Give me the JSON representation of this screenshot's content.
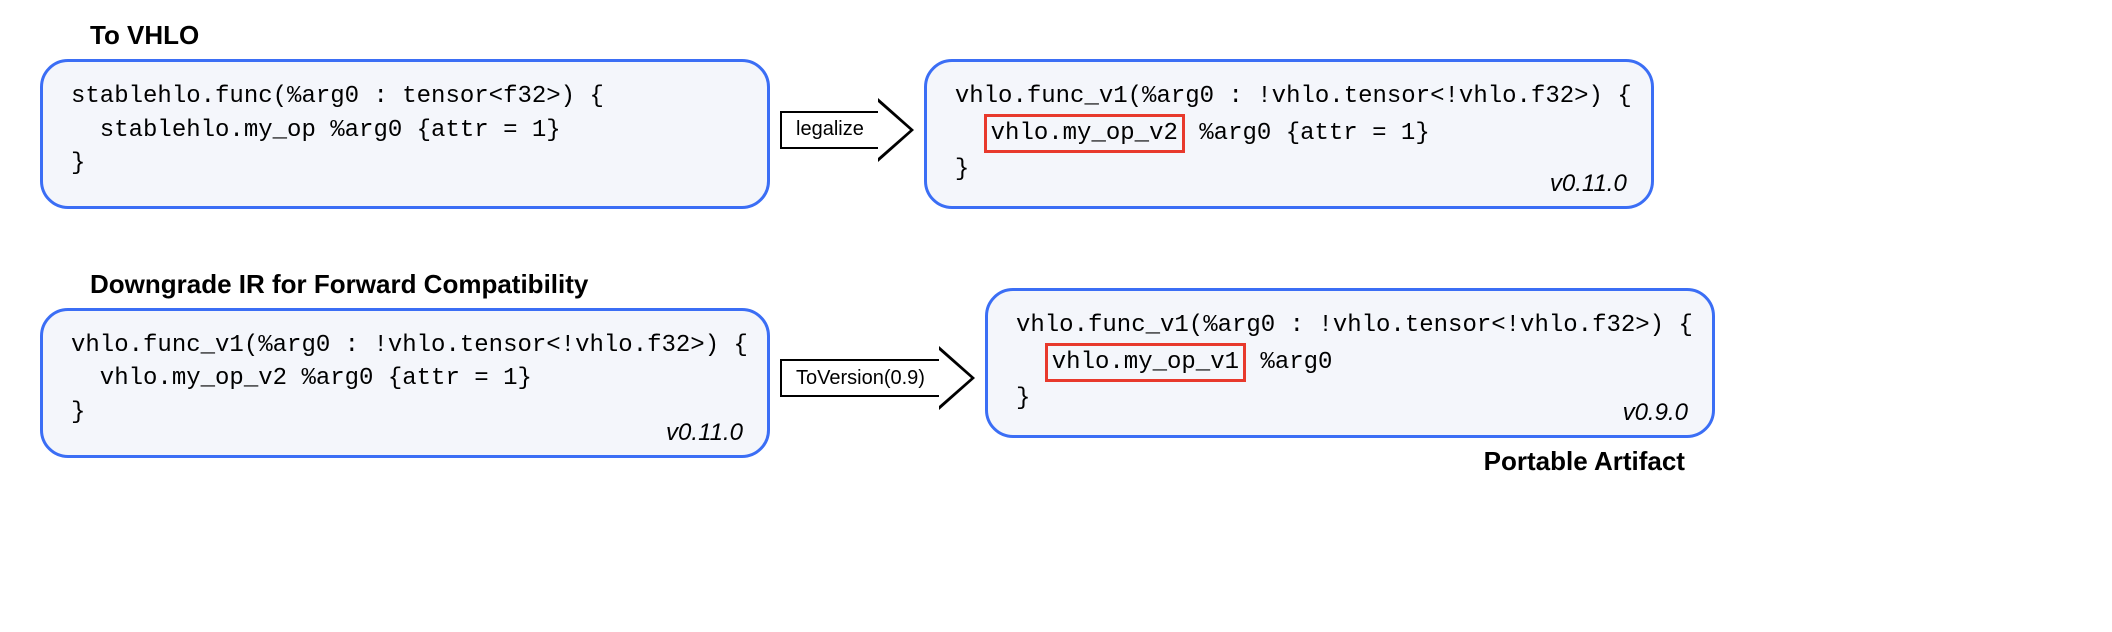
{
  "row1": {
    "title": "To VHLO",
    "left": {
      "line1": "stablehlo.func(%arg0 : tensor<f32>) {",
      "line2": "  stablehlo.my_op %arg0 {attr = 1}",
      "line3": "}",
      "version": ""
    },
    "arrow": "legalize",
    "right": {
      "line1": "vhlo.func_v1(%arg0 : !vhlo.tensor<!vhlo.f32>) {",
      "line2a": "  ",
      "highlight": "vhlo.my_op_v2",
      "line2b": " %arg0 {attr = 1}",
      "line3": "}",
      "version": "v0.11.0"
    }
  },
  "row2": {
    "title": "Downgrade IR for Forward Compatibility",
    "left": {
      "line1": "vhlo.func_v1(%arg0 : !vhlo.tensor<!vhlo.f32>) {",
      "line2": "  vhlo.my_op_v2 %arg0 {attr = 1}",
      "line3": "}",
      "version": "v0.11.0"
    },
    "arrow": "ToVersion(0.9)",
    "right": {
      "line1": "vhlo.func_v1(%arg0 : !vhlo.tensor<!vhlo.f32>) {",
      "line2a": "  ",
      "highlight": "vhlo.my_op_v1",
      "line2b": " %arg0",
      "line3": "}",
      "version": "v0.9.0"
    },
    "footer": "Portable Artifact"
  }
}
